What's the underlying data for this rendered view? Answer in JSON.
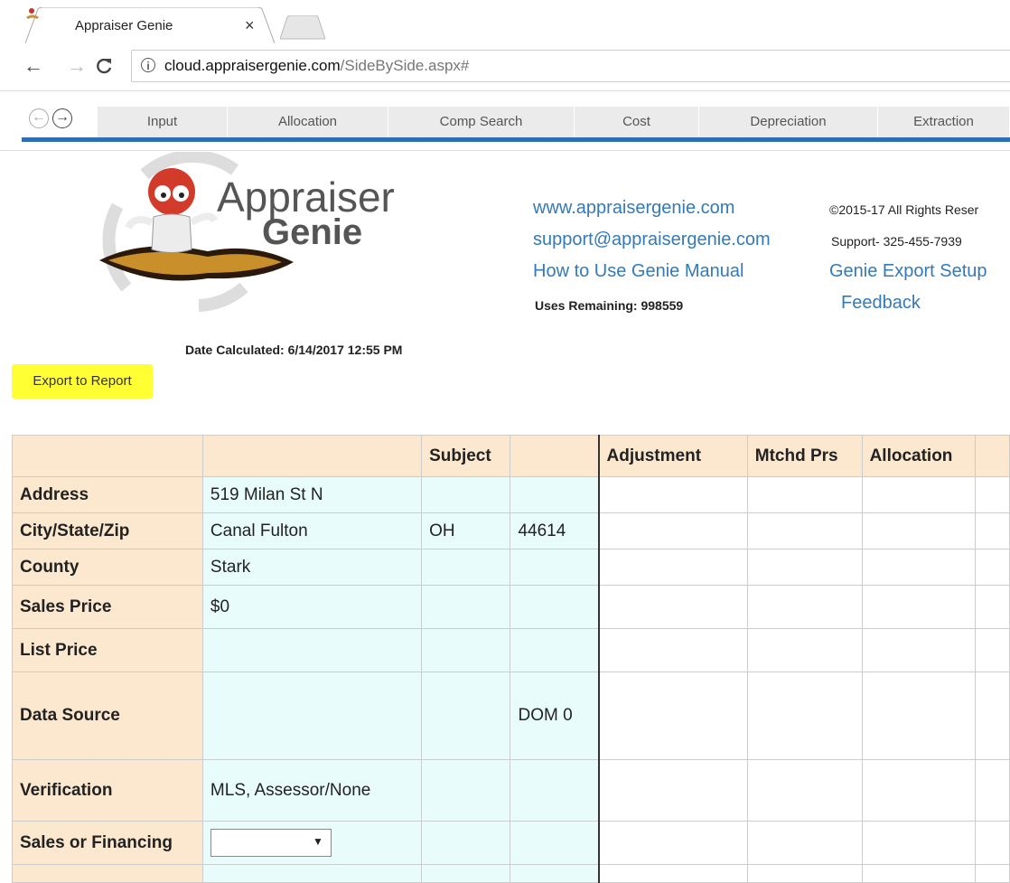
{
  "browser": {
    "tab_title": "Appraiser Genie",
    "tab_close": "×",
    "url_host": "cloud.appraisergenie.com",
    "url_path": "/SideBySide.aspx#"
  },
  "nav": {
    "items": [
      "Input",
      "Allocation",
      "Comp Search",
      "Cost",
      "Depreciation",
      "Extraction"
    ]
  },
  "header": {
    "logo_line1": "Appraiser",
    "logo_line2": "Genie",
    "website": "www.appraisergenie.com",
    "email": "support@appraisergenie.com",
    "manual": "How to Use Genie Manual",
    "uses_remaining": "Uses Remaining: 998559",
    "copyright": "©2015-17 All Rights Reser",
    "support_phone": "Support- 325-455-7939",
    "export_setup": "Genie Export Setup",
    "feedback": "Feedback",
    "date_calculated": "Date Calculated: 6/14/2017 12:55 PM"
  },
  "export_button": "Export to Report",
  "table": {
    "headers": [
      "",
      "",
      "Subject",
      "",
      "Adjustment",
      "Mtchd Prs",
      "Allocation",
      ""
    ],
    "rows": [
      {
        "label": "Address",
        "c1": "519 Milan St N",
        "c2": "",
        "c3": ""
      },
      {
        "label": "City/State/Zip",
        "c1": "Canal Fulton",
        "c2": "OH",
        "c3": "44614"
      },
      {
        "label": "County",
        "c1": "Stark",
        "c2": "",
        "c3": ""
      },
      {
        "label": "Sales Price",
        "c1": "$0",
        "c2": "",
        "c3": ""
      },
      {
        "label": "List Price",
        "c1": "",
        "c2": "",
        "c3": ""
      },
      {
        "label": "Data Source",
        "c1": "",
        "c2": "",
        "c3": "DOM 0"
      },
      {
        "label": "Verification",
        "c1": "MLS, Assessor/None",
        "c2": "",
        "c3": ""
      },
      {
        "label": "Sales or Financing",
        "c1": "",
        "c2": "",
        "c3": ""
      }
    ]
  },
  "colors": {
    "label_bg": "#fce8cf",
    "data_bg": "#e9fcfc",
    "accent": "#2f6fb5",
    "link": "#337ab7",
    "export_highlight": "#ffff33"
  }
}
